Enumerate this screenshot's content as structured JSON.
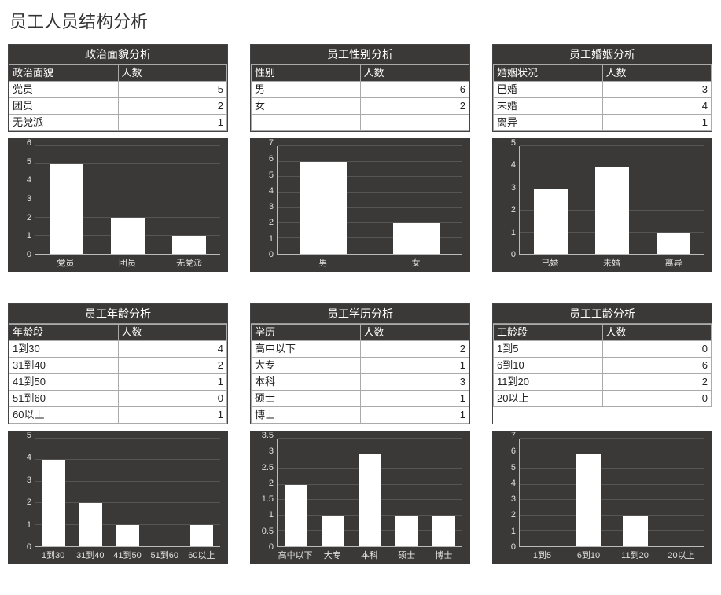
{
  "page_title": "员工人员结构分析",
  "panels": [
    {
      "title": "政治面貌分析",
      "col_label_header": "政治面貌",
      "col_value_header": "人数",
      "rows": [
        {
          "label": "党员",
          "value": 5
        },
        {
          "label": "团员",
          "value": 2
        },
        {
          "label": "无党派",
          "value": 1
        }
      ],
      "blank_rows": 0,
      "chart_ymax": 6,
      "chart_ystep": 1,
      "bar_width_pct": 55
    },
    {
      "title": "员工性别分析",
      "col_label_header": "性别",
      "col_value_header": "人数",
      "rows": [
        {
          "label": "男",
          "value": 6
        },
        {
          "label": "女",
          "value": 2
        }
      ],
      "blank_rows": 1,
      "chart_ymax": 7,
      "chart_ystep": 1,
      "bar_width_pct": 50
    },
    {
      "title": "员工婚姻分析",
      "col_label_header": "婚姻状况",
      "col_value_header": "人数",
      "rows": [
        {
          "label": "已婚",
          "value": 3
        },
        {
          "label": "未婚",
          "value": 4
        },
        {
          "label": "离异",
          "value": 1
        }
      ],
      "blank_rows": 0,
      "chart_ymax": 5,
      "chart_ystep": 1,
      "bar_width_pct": 55
    },
    {
      "title": "员工年龄分析",
      "col_label_header": "年龄段",
      "col_value_header": "人数",
      "rows": [
        {
          "label": "1到30",
          "value": 4
        },
        {
          "label": "31到40",
          "value": 2
        },
        {
          "label": "41到50",
          "value": 1
        },
        {
          "label": "51到60",
          "value": 0
        },
        {
          "label": "60以上",
          "value": 1
        }
      ],
      "blank_rows": 0,
      "chart_ymax": 5,
      "chart_ystep": 1,
      "bar_width_pct": 60
    },
    {
      "title": "员工学历分析",
      "col_label_header": "学历",
      "col_value_header": "人数",
      "rows": [
        {
          "label": "高中以下",
          "value": 2
        },
        {
          "label": "大专",
          "value": 1
        },
        {
          "label": "本科",
          "value": 3
        },
        {
          "label": "硕士",
          "value": 1
        },
        {
          "label": "博士",
          "value": 1
        }
      ],
      "blank_rows": 0,
      "chart_ymax": 3.5,
      "chart_ystep": 0.5,
      "bar_width_pct": 60
    },
    {
      "title": "员工工龄分析",
      "col_label_header": "工龄段",
      "col_value_header": "人数",
      "rows": [
        {
          "label": "1到5",
          "value": 0
        },
        {
          "label": "6到10",
          "value": 6
        },
        {
          "label": "11到20",
          "value": 2
        },
        {
          "label": "20以上",
          "value": 0
        }
      ],
      "blank_rows": 0,
      "chart_ymax": 7,
      "chart_ystep": 1,
      "bar_width_pct": 55
    }
  ],
  "chart_data": [
    {
      "type": "bar",
      "title": "政治面貌分析",
      "categories": [
        "党员",
        "团员",
        "无党派"
      ],
      "values": [
        5,
        2,
        1
      ],
      "ylim": [
        0,
        6
      ]
    },
    {
      "type": "bar",
      "title": "员工性别分析",
      "categories": [
        "男",
        "女"
      ],
      "values": [
        6,
        2
      ],
      "ylim": [
        0,
        7
      ]
    },
    {
      "type": "bar",
      "title": "员工婚姻分析",
      "categories": [
        "已婚",
        "未婚",
        "离异"
      ],
      "values": [
        3,
        4,
        1
      ],
      "ylim": [
        0,
        5
      ]
    },
    {
      "type": "bar",
      "title": "员工年龄分析",
      "categories": [
        "1到30",
        "31到40",
        "41到50",
        "51到60",
        "60以上"
      ],
      "values": [
        4,
        2,
        1,
        0,
        1
      ],
      "ylim": [
        0,
        5
      ]
    },
    {
      "type": "bar",
      "title": "员工学历分析",
      "categories": [
        "高中以下",
        "大专",
        "本科",
        "硕士",
        "博士"
      ],
      "values": [
        2,
        1,
        3,
        1,
        1
      ],
      "ylim": [
        0,
        3.5
      ]
    },
    {
      "type": "bar",
      "title": "员工工龄分析",
      "categories": [
        "1到5",
        "6到10",
        "11到20",
        "20以上"
      ],
      "values": [
        0,
        6,
        2,
        0
      ],
      "ylim": [
        0,
        7
      ]
    }
  ]
}
